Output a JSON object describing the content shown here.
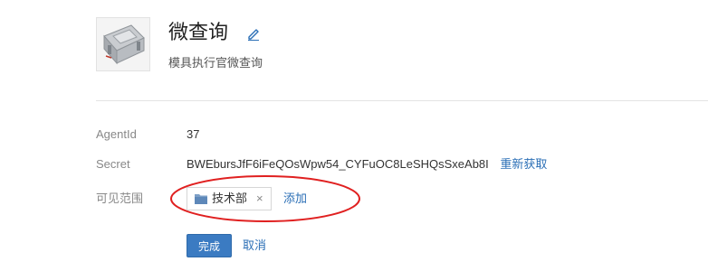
{
  "app": {
    "name": "微查询",
    "description": "模具执行官微查询"
  },
  "fields": {
    "agent_id": {
      "label": "AgentId",
      "value": "37"
    },
    "secret": {
      "label": "Secret",
      "value": "BWEbursJfF6iFeQOsWpw54_CYFuOC8LeSHQsSxeAb8I",
      "refresh_label": "重新获取"
    },
    "scope": {
      "label": "可见范围",
      "tags": [
        {
          "name": "技术部",
          "remove": "×"
        }
      ],
      "add_label": "添加"
    }
  },
  "actions": {
    "done_label": "完成",
    "cancel_label": "取消"
  },
  "colors": {
    "link": "#2b6fb6",
    "primary_button": "#3b7bc2",
    "annotation": "#e02020"
  },
  "icons": {
    "edit": "pencil-icon",
    "folder": "folder-icon",
    "close": "close-icon"
  }
}
